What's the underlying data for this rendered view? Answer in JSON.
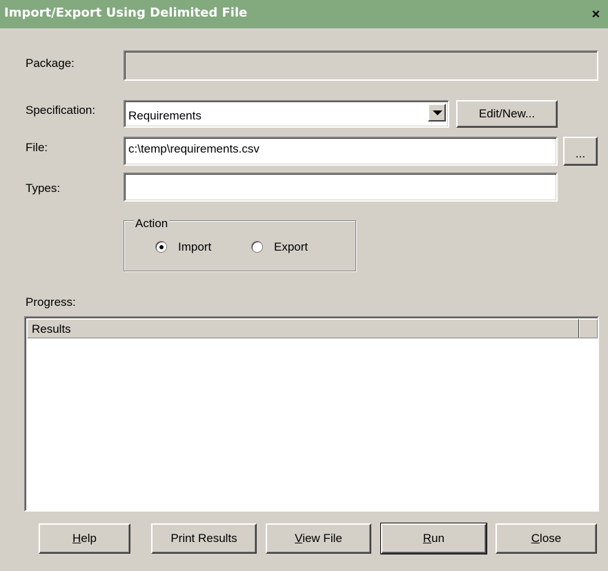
{
  "window": {
    "title": "Import/Export Using Delimited File",
    "close_label": "×"
  },
  "form": {
    "package_label": "Package:",
    "package_value": "",
    "specification_label": "Specification:",
    "specification_value": "Requirements",
    "edit_new_label": "Edit/New...",
    "file_label": "File:",
    "file_value": "c:\\temp\\requirements.csv",
    "browse_label": "...",
    "types_label": "Types:",
    "types_value": ""
  },
  "action": {
    "legend": "Action",
    "options": [
      {
        "label": "Import",
        "selected": true
      },
      {
        "label": "Export",
        "selected": false
      }
    ]
  },
  "progress": {
    "label": "Progress:",
    "column_header": "Results"
  },
  "buttons": {
    "help": {
      "prefix": "",
      "mnemonic": "H",
      "rest": "elp"
    },
    "print_results": "Print Results",
    "view_file": {
      "prefix": "",
      "mnemonic": "V",
      "rest": "iew File"
    },
    "run": {
      "prefix": "",
      "mnemonic": "R",
      "rest": "un"
    },
    "close": {
      "prefix": "",
      "mnemonic": "C",
      "rest": "lose"
    }
  }
}
